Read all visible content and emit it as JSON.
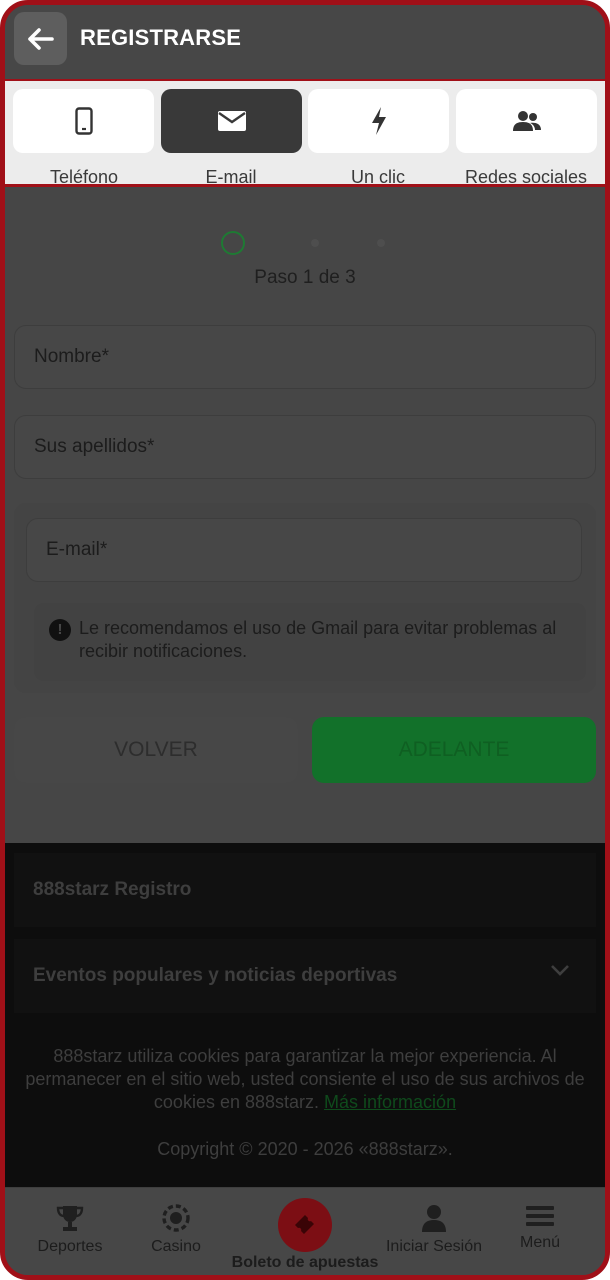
{
  "header": {
    "title": "REGISTRARSE"
  },
  "tabs": [
    {
      "label": "Teléfono",
      "icon": "phone-icon",
      "active": false
    },
    {
      "label": "E-mail",
      "icon": "envelope-icon",
      "active": true
    },
    {
      "label": "Un clic",
      "icon": "lightning-icon",
      "active": false
    },
    {
      "label": "Redes sociales",
      "icon": "users-icon",
      "active": false
    }
  ],
  "form": {
    "step_text": "Paso 1 de 3",
    "first_name_placeholder": "Nombre*",
    "last_name_placeholder": "Sus apellidos*",
    "email_placeholder": "E-mail*",
    "notice": "Le recomendamos el uso de Gmail para evitar problemas al recibir notificaciones.",
    "back_label": "VOLVER",
    "next_label": "ADELANTE"
  },
  "footer": {
    "registro_title": "888starz Registro",
    "events_title": "Eventos populares y noticias deportivas",
    "cookies_text": "888starz utiliza cookies para garantizar la mejor experiencia. Al permanecer en el sitio web, usted consiente el uso de sus archivos de cookies en 888starz.",
    "cookies_link": "Más información",
    "copyright": "Copyright © 2020 - 2026 «888starz»."
  },
  "bottom_nav": [
    {
      "label": "Deportes",
      "icon": "trophy-icon"
    },
    {
      "label": "Casino",
      "icon": "casino-chip-icon"
    },
    {
      "label": "Boleto de apuestas",
      "icon": "ticket-icon"
    },
    {
      "label": "Iniciar Sesión",
      "icon": "user-icon"
    },
    {
      "label": "Menú",
      "icon": "hamburger-icon"
    }
  ],
  "colors": {
    "accent_green": "#12712a",
    "frame_red": "#a01018",
    "header_bg": "#474747"
  }
}
